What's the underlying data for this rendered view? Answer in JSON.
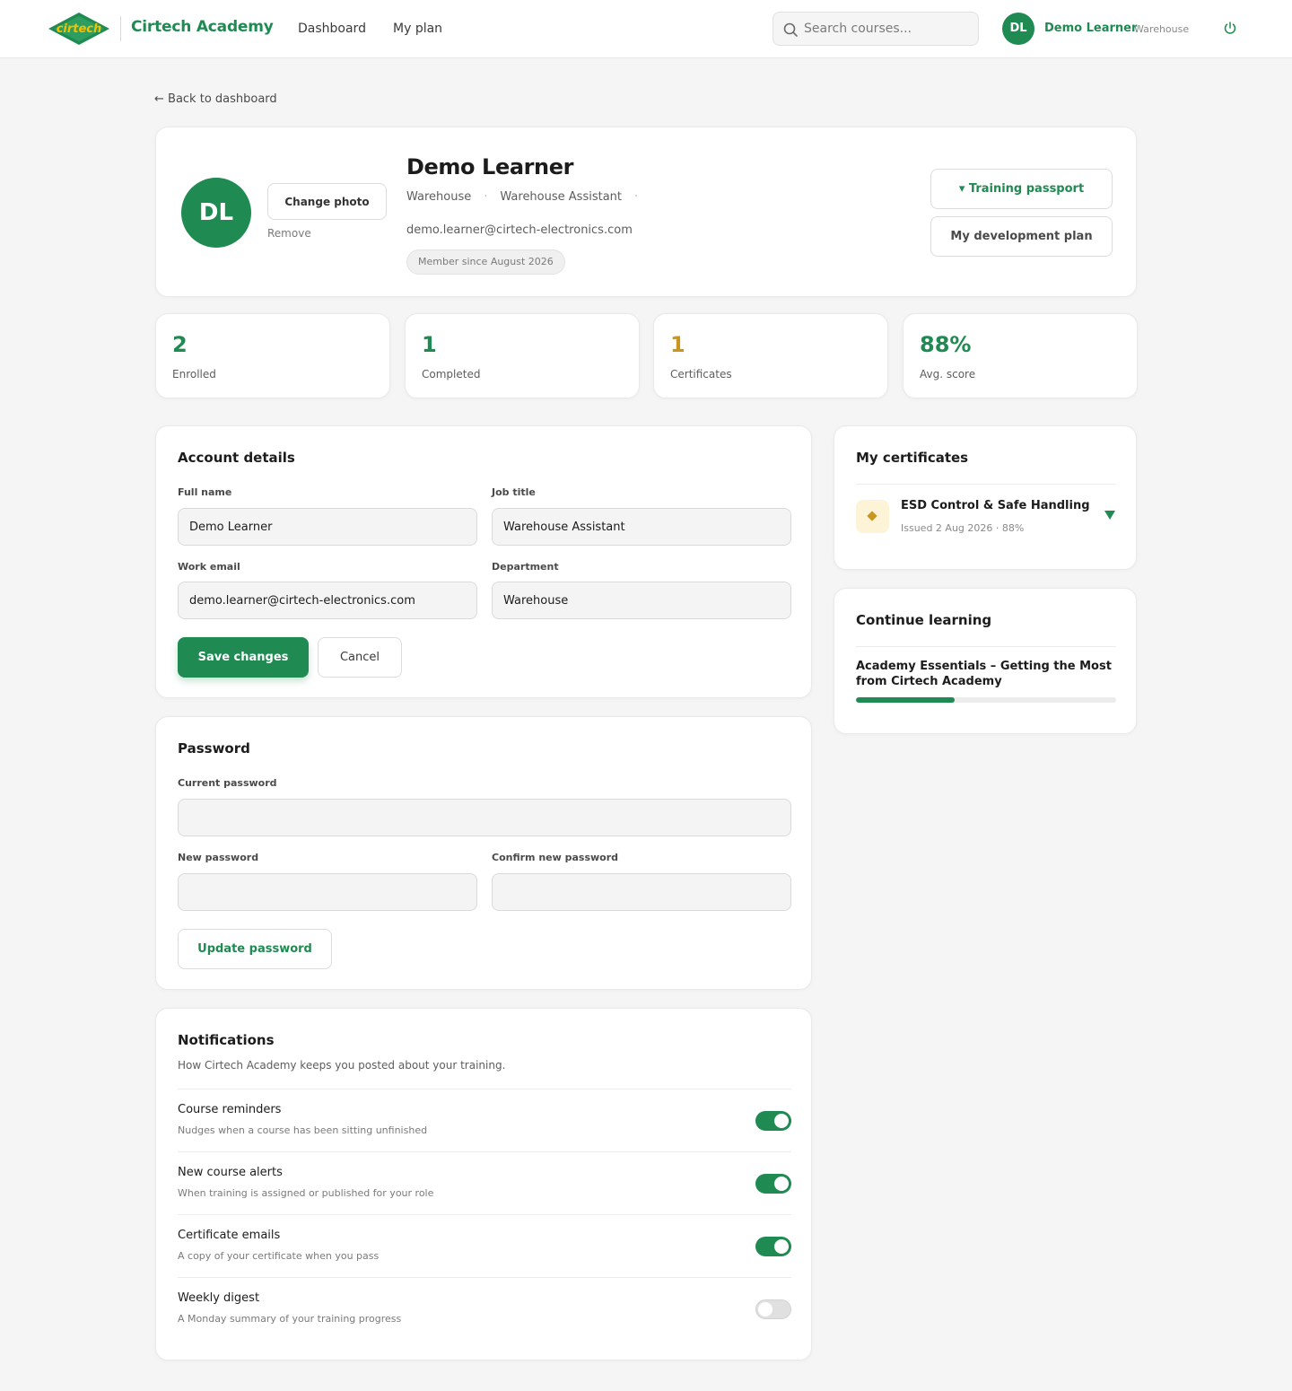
{
  "colors": {
    "brand": "#1f8a52",
    "gold": "#c9961e",
    "logo_yellow": "#f2c200",
    "text": "#1c1c1c",
    "muted": "#7a7a7a"
  },
  "header": {
    "logo_icon": "cirtech-logo",
    "logo_text": "cirtech",
    "app_title": "Cirtech Academy",
    "nav": {
      "dashboard": "Dashboard",
      "my_plan": "My plan"
    },
    "search": {
      "placeholder": "Search courses...",
      "value": ""
    },
    "user": {
      "initials": "DL",
      "name": "Demo Learner",
      "department": "Warehouse"
    },
    "power_icon": "power-icon"
  },
  "back_link": "← Back to dashboard",
  "profile": {
    "initials": "DL",
    "change_photo_label": "Change photo",
    "remove_label": "Remove",
    "name": "Demo Learner",
    "department": "Warehouse",
    "separator": "·",
    "job_title": "Warehouse Assistant",
    "email": "demo.learner@cirtech-electronics.com",
    "member_since": "Member since August 2026",
    "training_passport_label": "▾ Training passport",
    "development_plan_label": "My development plan"
  },
  "stats": [
    {
      "value": "2",
      "label": "Enrolled",
      "color": "#1f8a52"
    },
    {
      "value": "1",
      "label": "Completed",
      "color": "#1f8a52"
    },
    {
      "value": "1",
      "label": "Certificates",
      "color": "#c9961e"
    },
    {
      "value": "88%",
      "label": "Avg. score",
      "color": "#1f8a52"
    }
  ],
  "account": {
    "title": "Account details",
    "full_name_label": "Full name",
    "full_name_value": "Demo Learner",
    "job_title_label": "Job title",
    "job_title_value": "Warehouse Assistant",
    "work_email_label": "Work email",
    "work_email_value": "demo.learner@cirtech-electronics.com",
    "department_label": "Department",
    "department_value": "Warehouse",
    "save_label": "Save changes",
    "cancel_label": "Cancel"
  },
  "password": {
    "title": "Password",
    "current_label": "Current password",
    "new_label": "New password",
    "confirm_label": "Confirm new password",
    "update_label": "Update password"
  },
  "notifications": {
    "title": "Notifications",
    "subtitle": "How Cirtech Academy keeps you posted about your training.",
    "items": [
      {
        "title": "Course reminders",
        "description": "Nudges when a course has been sitting unfinished",
        "enabled": true
      },
      {
        "title": "New course alerts",
        "description": "When training is assigned or published for your role",
        "enabled": true
      },
      {
        "title": "Certificate emails",
        "description": "A copy of your certificate when you pass",
        "enabled": true
      },
      {
        "title": "Weekly digest",
        "description": "A Monday summary of your training progress",
        "enabled": false
      }
    ]
  },
  "certificates": {
    "title": "My certificates",
    "items": [
      {
        "name": "ESD Control & Safe Handling",
        "meta": "Issued 2 Aug 2026 · 88%",
        "icon": "certificate-diamond-icon",
        "expand_icon": "expand-triangle-icon"
      }
    ]
  },
  "continue_learning": {
    "title": "Continue learning",
    "course": {
      "title": "Academy Essentials – Getting the Most from Cirtech Academy",
      "progress": 0.38
    }
  }
}
